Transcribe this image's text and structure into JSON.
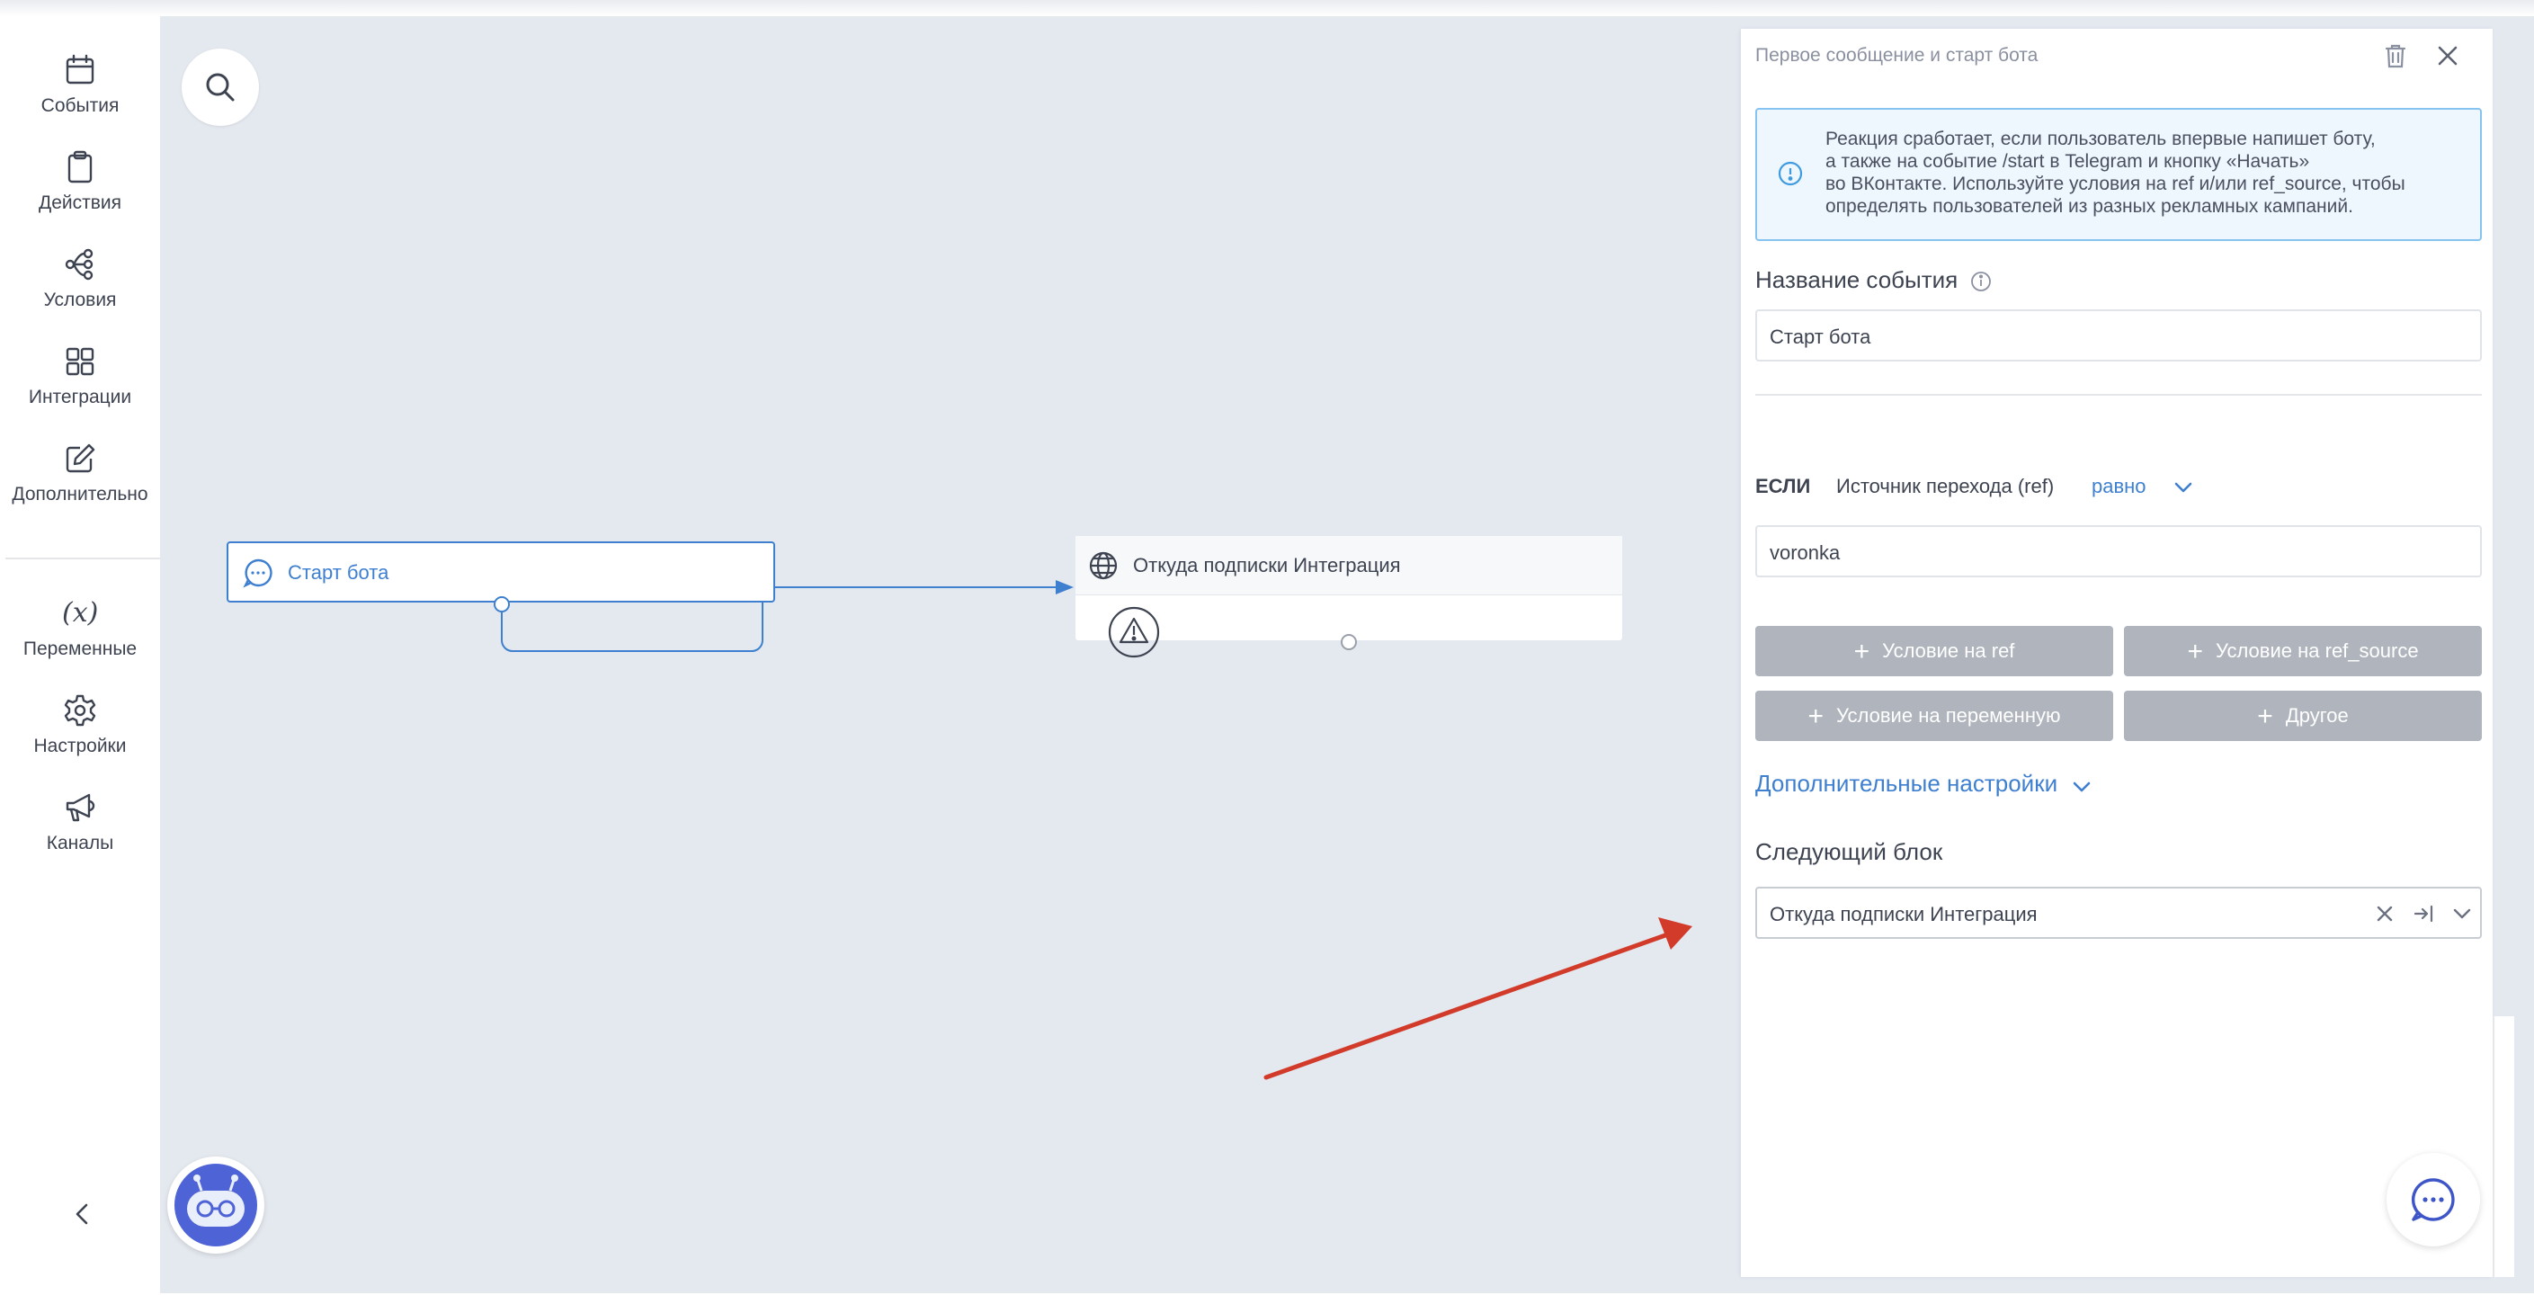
{
  "sidebar": {
    "items": [
      {
        "label": "События",
        "icon": "calendar-icon"
      },
      {
        "label": "Действия",
        "icon": "clipboard-icon"
      },
      {
        "label": "Условия",
        "icon": "branch-icon"
      },
      {
        "label": "Интеграции",
        "icon": "grid-icon"
      },
      {
        "label": "Дополнительно",
        "icon": "edit-icon"
      },
      {
        "label": "Переменные",
        "icon": "variable-icon",
        "glyph": "(x)"
      },
      {
        "label": "Настройки",
        "icon": "gear-icon"
      },
      {
        "label": "Каналы",
        "icon": "megaphone-icon"
      }
    ]
  },
  "canvas": {
    "start_node": {
      "label": "Старт бота"
    },
    "integration_node": {
      "label": "Откуда подписки Интеграция"
    }
  },
  "panel": {
    "title": "Первое сообщение и старт бота",
    "info_lines": [
      "Реакция сработает, если пользователь впервые напишет боту,",
      "а также на событие /start в Telegram и кнопку «Начать»",
      "во ВКонтакте. Используйте условия на ref и/или ref_source, чтобы",
      "определять пользователей из разных рекламных кампаний."
    ],
    "event_name_label": "Название события",
    "event_name_value": "Старт бота",
    "condition": {
      "if_label": "ЕСЛИ",
      "source": "Источник перехода (ref)",
      "operator": "равно",
      "value": "voronka"
    },
    "buttons": {
      "cond_ref": "Условие на ref",
      "cond_ref_source": "Условие на ref_source",
      "cond_variable": "Условие на переменную",
      "other": "Другое"
    },
    "advanced_settings": "Дополнительные настройки",
    "next_block_label": "Следующий блок",
    "next_block_value": "Откуда подписки Интеграция"
  },
  "colors": {
    "accent": "#3e7fd0",
    "canvas_bg": "#e4e8ef",
    "button_gray": "#b0b5bd",
    "info_bg": "#eef6fe",
    "info_border": "#86c3f0",
    "annotation_arrow": "#d23a2a"
  }
}
